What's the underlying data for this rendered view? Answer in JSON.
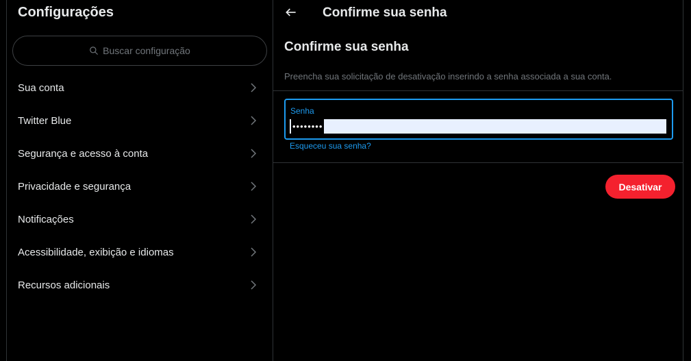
{
  "sidebar": {
    "title": "Configurações",
    "search_placeholder": "Buscar configuração",
    "items": [
      {
        "label": "Sua conta"
      },
      {
        "label": "Twitter Blue"
      },
      {
        "label": "Segurança e acesso à conta"
      },
      {
        "label": "Privacidade e segurança"
      },
      {
        "label": "Notificações"
      },
      {
        "label": "Acessibilidade, exibição e idiomas"
      },
      {
        "label": "Recursos adicionais"
      }
    ]
  },
  "detail": {
    "header_title": "Confirme sua senha",
    "section_title": "Confirme sua senha",
    "description": "Preencha sua solicitação de desativação inserindo a senha associada a sua conta.",
    "password_field": {
      "label": "Senha",
      "masked_value": "••••••••"
    },
    "forgot_link": "Esqueceu sua senha?",
    "deactivate_label": "Desativar"
  },
  "colors": {
    "background": "#000000",
    "accent": "#1d9bf0",
    "danger": "#f4212e",
    "text_primary": "#e7e9ea",
    "text_secondary": "#71767b",
    "border": "#2f3336"
  },
  "icons": {
    "search": "search-icon",
    "back": "back-arrow-icon",
    "chevron": "chevron-right-icon"
  }
}
